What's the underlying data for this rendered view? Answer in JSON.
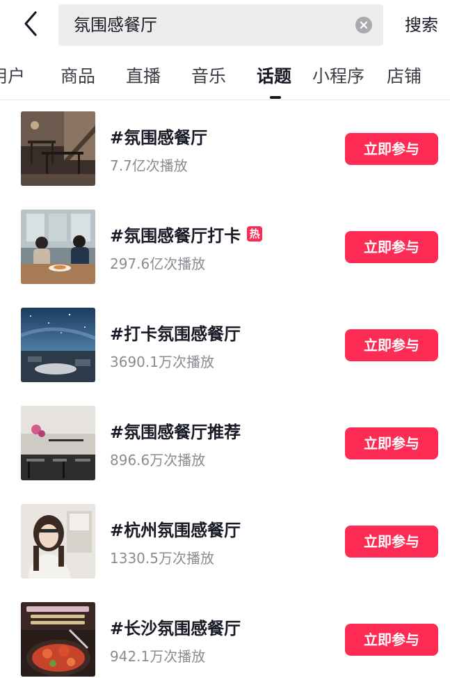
{
  "search": {
    "query": "氛围感餐厅",
    "submit_label": "搜索"
  },
  "tabs": [
    {
      "label": "用户",
      "active": false
    },
    {
      "label": "商品",
      "active": false
    },
    {
      "label": "直播",
      "active": false
    },
    {
      "label": "音乐",
      "active": false
    },
    {
      "label": "话题",
      "active": true
    },
    {
      "label": "小程序",
      "active": false
    },
    {
      "label": "店铺",
      "active": false
    }
  ],
  "icons": {
    "back": "chevron-left-icon",
    "clear": "clear-circle-icon"
  },
  "colors": {
    "accent": "#fe2c55",
    "text_primary": "#161823",
    "text_secondary": "#8a8b91",
    "search_bg": "#ececed"
  },
  "topics": [
    {
      "title": "#氛围感餐厅",
      "plays": "7.7亿次播放",
      "hot": false,
      "hot_label": "",
      "button": "立即参与"
    },
    {
      "title": "#氛围感餐厅打卡",
      "plays": "297.6亿次播放",
      "hot": true,
      "hot_label": "热",
      "button": "立即参与"
    },
    {
      "title": "#打卡氛围感餐厅",
      "plays": "3690.1万次播放",
      "hot": false,
      "hot_label": "",
      "button": "立即参与"
    },
    {
      "title": "#氛围感餐厅推荐",
      "plays": "896.6万次播放",
      "hot": false,
      "hot_label": "",
      "button": "立即参与"
    },
    {
      "title": "#杭州氛围感餐厅",
      "plays": "1330.5万次播放",
      "hot": false,
      "hot_label": "",
      "button": "立即参与"
    },
    {
      "title": "#长沙氛围感餐厅",
      "plays": "942.1万次播放",
      "hot": false,
      "hot_label": "",
      "button": "立即参与"
    }
  ]
}
